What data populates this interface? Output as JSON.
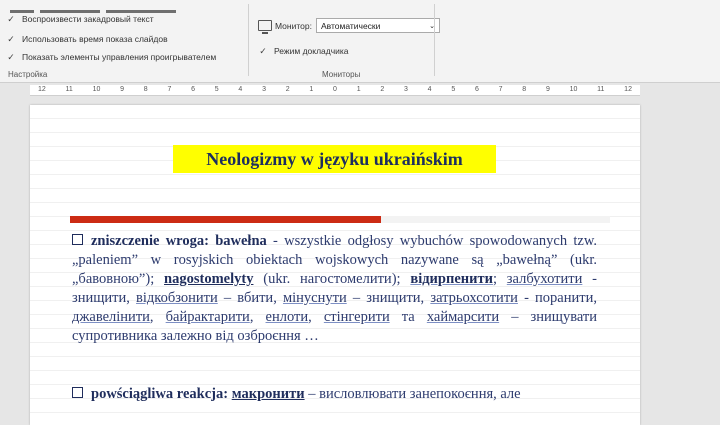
{
  "ribbon": {
    "options": [
      "Воспроизвести закадровый текст",
      "Использовать время показа слайдов",
      "Показать элементы управления проигрывателем"
    ],
    "setup_group_label": "Настройка",
    "monitor_label": "Монитор:",
    "monitor_value": "Автоматически",
    "presenter_view_label": "Режим докладчика",
    "monitors_group_label": "Мониторы"
  },
  "ruler": [
    "12",
    "11",
    "10",
    "9",
    "8",
    "7",
    "6",
    "5",
    "4",
    "3",
    "2",
    "1",
    "0",
    "1",
    "2",
    "3",
    "4",
    "5",
    "6",
    "7",
    "8",
    "9",
    "10",
    "11",
    "12"
  ],
  "slide": {
    "title": "Neologizmy w języku ukraińskim",
    "accent_colors": {
      "bar_red": "#cc2b14",
      "title_highlight": "#ffff00"
    },
    "bullet1": {
      "heading": "zniszczenie wroga: bawełna",
      "t1": " - wszystkie odgłosy wybuchów spowodowanych tzw. „paleniem” w rosyjskich obiektach wojskowych nazywane są „bawełną” (ukr. „бавовною”); ",
      "w_nagost": "nagostomelyty",
      "t2": " (ukr. нагостомелити); ",
      "w_vidirp": "відирпенити",
      "t3": "; ",
      "w_zalbuh": "залбухотити",
      "t4": " - знищити, ",
      "w_vidkob": "відкобзонити",
      "t5": " – вбити, ",
      "w_minus": "мінуснути",
      "t6": " – знищити, ",
      "w_zatr": "затрьохсотити",
      "t7": " - поранити, ",
      "w_dzhav": "джавелінити",
      "t8": ", ",
      "w_bayr": "байрактарити",
      "t9": ", ",
      "w_enlo": "енлоти",
      "t10": ", ",
      "w_sting": "стінгерити",
      "t11": " та ",
      "w_haym": "хаймарсити",
      "t12": " – знищувати супротивника залежно від озброєння …"
    },
    "bullet2": {
      "heading": "powściągliwa reakcja: ",
      "word": "макронити",
      "tail": " – висловлювати занепокоєння, але"
    }
  }
}
